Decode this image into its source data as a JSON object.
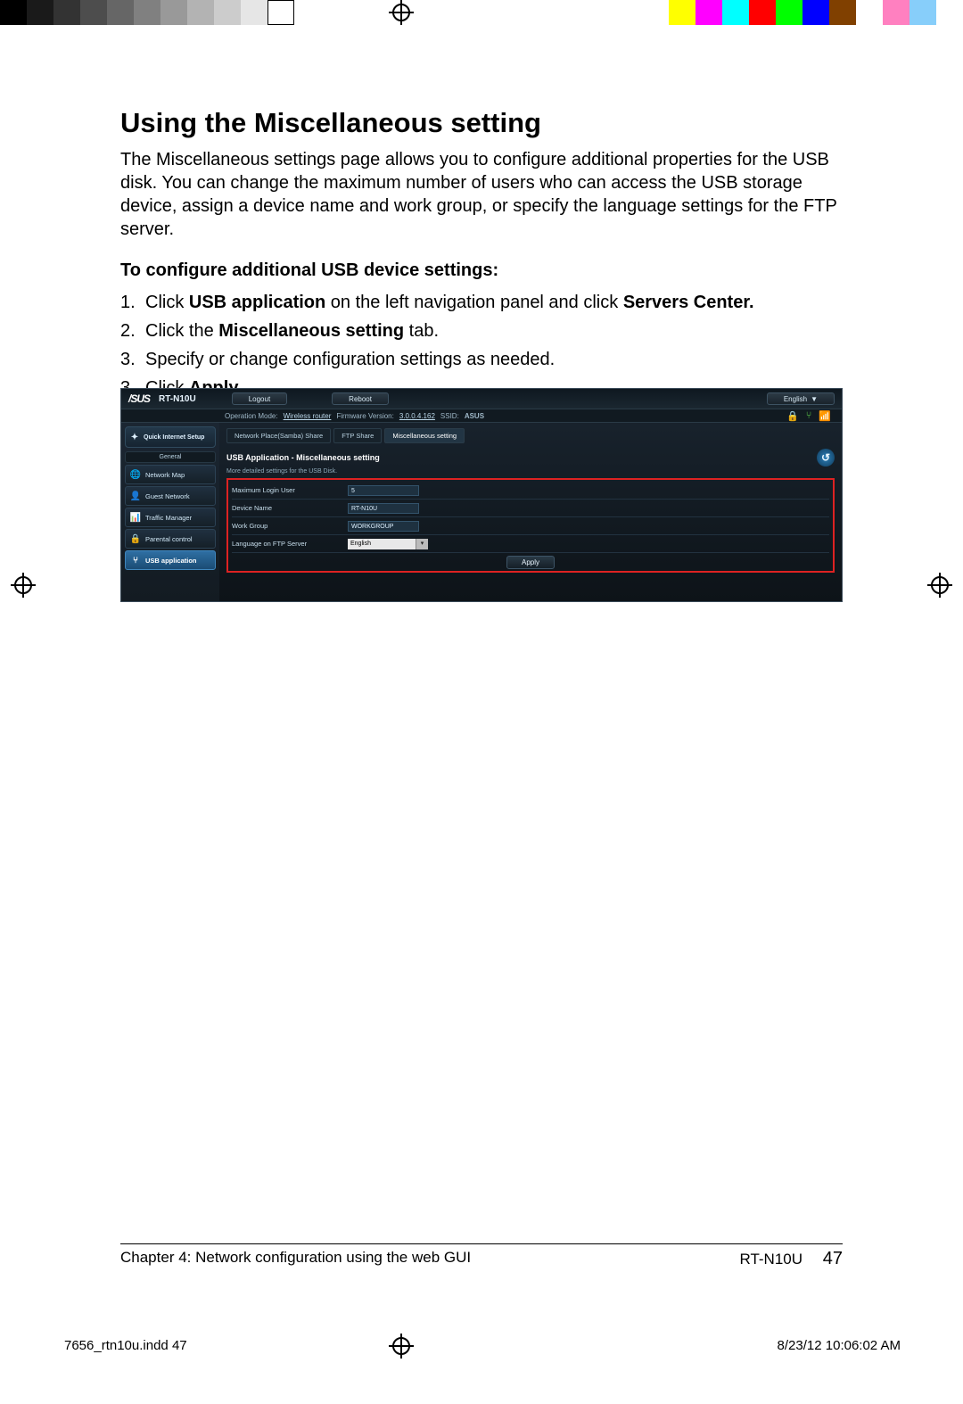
{
  "doc": {
    "heading": "Using the Miscellaneous setting",
    "intro": "The Miscellaneous settings page allows you to configure additional properties for the USB disk. You can change the maximum number of users who can access the USB storage device, assign a device name and work group, or specify the language settings for the FTP server.",
    "subheading": "To configure additional USB device settings:",
    "steps": {
      "s1_a": "Click ",
      "s1_b": "USB application",
      "s1_c": " on the left navigation panel and click ",
      "s1_d": "Servers Center.",
      "s2_a": "Click the ",
      "s2_b": "Miscellaneous setting",
      "s2_c": " tab.",
      "s3": "Specify or change configuration settings as needed.",
      "s4_a": "Click ",
      "s4_b": "Apply",
      "s4_c": "."
    },
    "footer_chapter": "Chapter 4: Network configuration using the web GUI",
    "footer_model": "RT-N10U",
    "page_number": "47",
    "slug_file": "7656_rtn10u.indd   47",
    "slug_date": "8/23/12   10:06:02 AM"
  },
  "router": {
    "brand": "/SUS",
    "model": "RT-N10U",
    "logout": "Logout",
    "reboot": "Reboot",
    "language": "English",
    "opmode_label": "Operation Mode:",
    "opmode_value": "Wireless router",
    "fw_label": "Firmware Version:",
    "fw_value": "3.0.0.4.162",
    "ssid_label": "SSID:",
    "ssid_value": "ASUS",
    "qis": "Quick Internet Setup",
    "section_general": "General",
    "nav": {
      "map": "Network Map",
      "guest": "Guest Network",
      "traffic": "Traffic Manager",
      "parental": "Parental control",
      "usb": "USB application"
    },
    "tabs": {
      "samba": "Network Place(Samba) Share",
      "ftp": "FTP Share",
      "misc": "Miscellaneous setting"
    },
    "panel_title": "USB Application - Miscellaneous setting",
    "panel_sub": "More detailed settings for the USB Disk.",
    "form": {
      "max_login_label": "Maximum Login User",
      "max_login_value": "5",
      "device_name_label": "Device Name",
      "device_name_value": "RT-N10U",
      "workgroup_label": "Work Group",
      "workgroup_value": "WORKGROUP",
      "ftp_lang_label": "Language on FTP Server",
      "ftp_lang_value": "English"
    },
    "apply": "Apply"
  },
  "colorbar": {
    "left": [
      "#000000",
      "#1a1a1a",
      "#333333",
      "#4d4d4d",
      "#666666",
      "#808080",
      "#999999",
      "#b3b3b3",
      "#cccccc",
      "#e6e6e6",
      "#ffffff"
    ],
    "right": [
      "#ffffff",
      "#ffff00",
      "#ff00ff",
      "#00ffff",
      "#ff0000",
      "#00ff00",
      "#0000ff",
      "#804000",
      "#ffffff",
      "#ff80c0",
      "#87cefa",
      "#ffffff"
    ]
  }
}
